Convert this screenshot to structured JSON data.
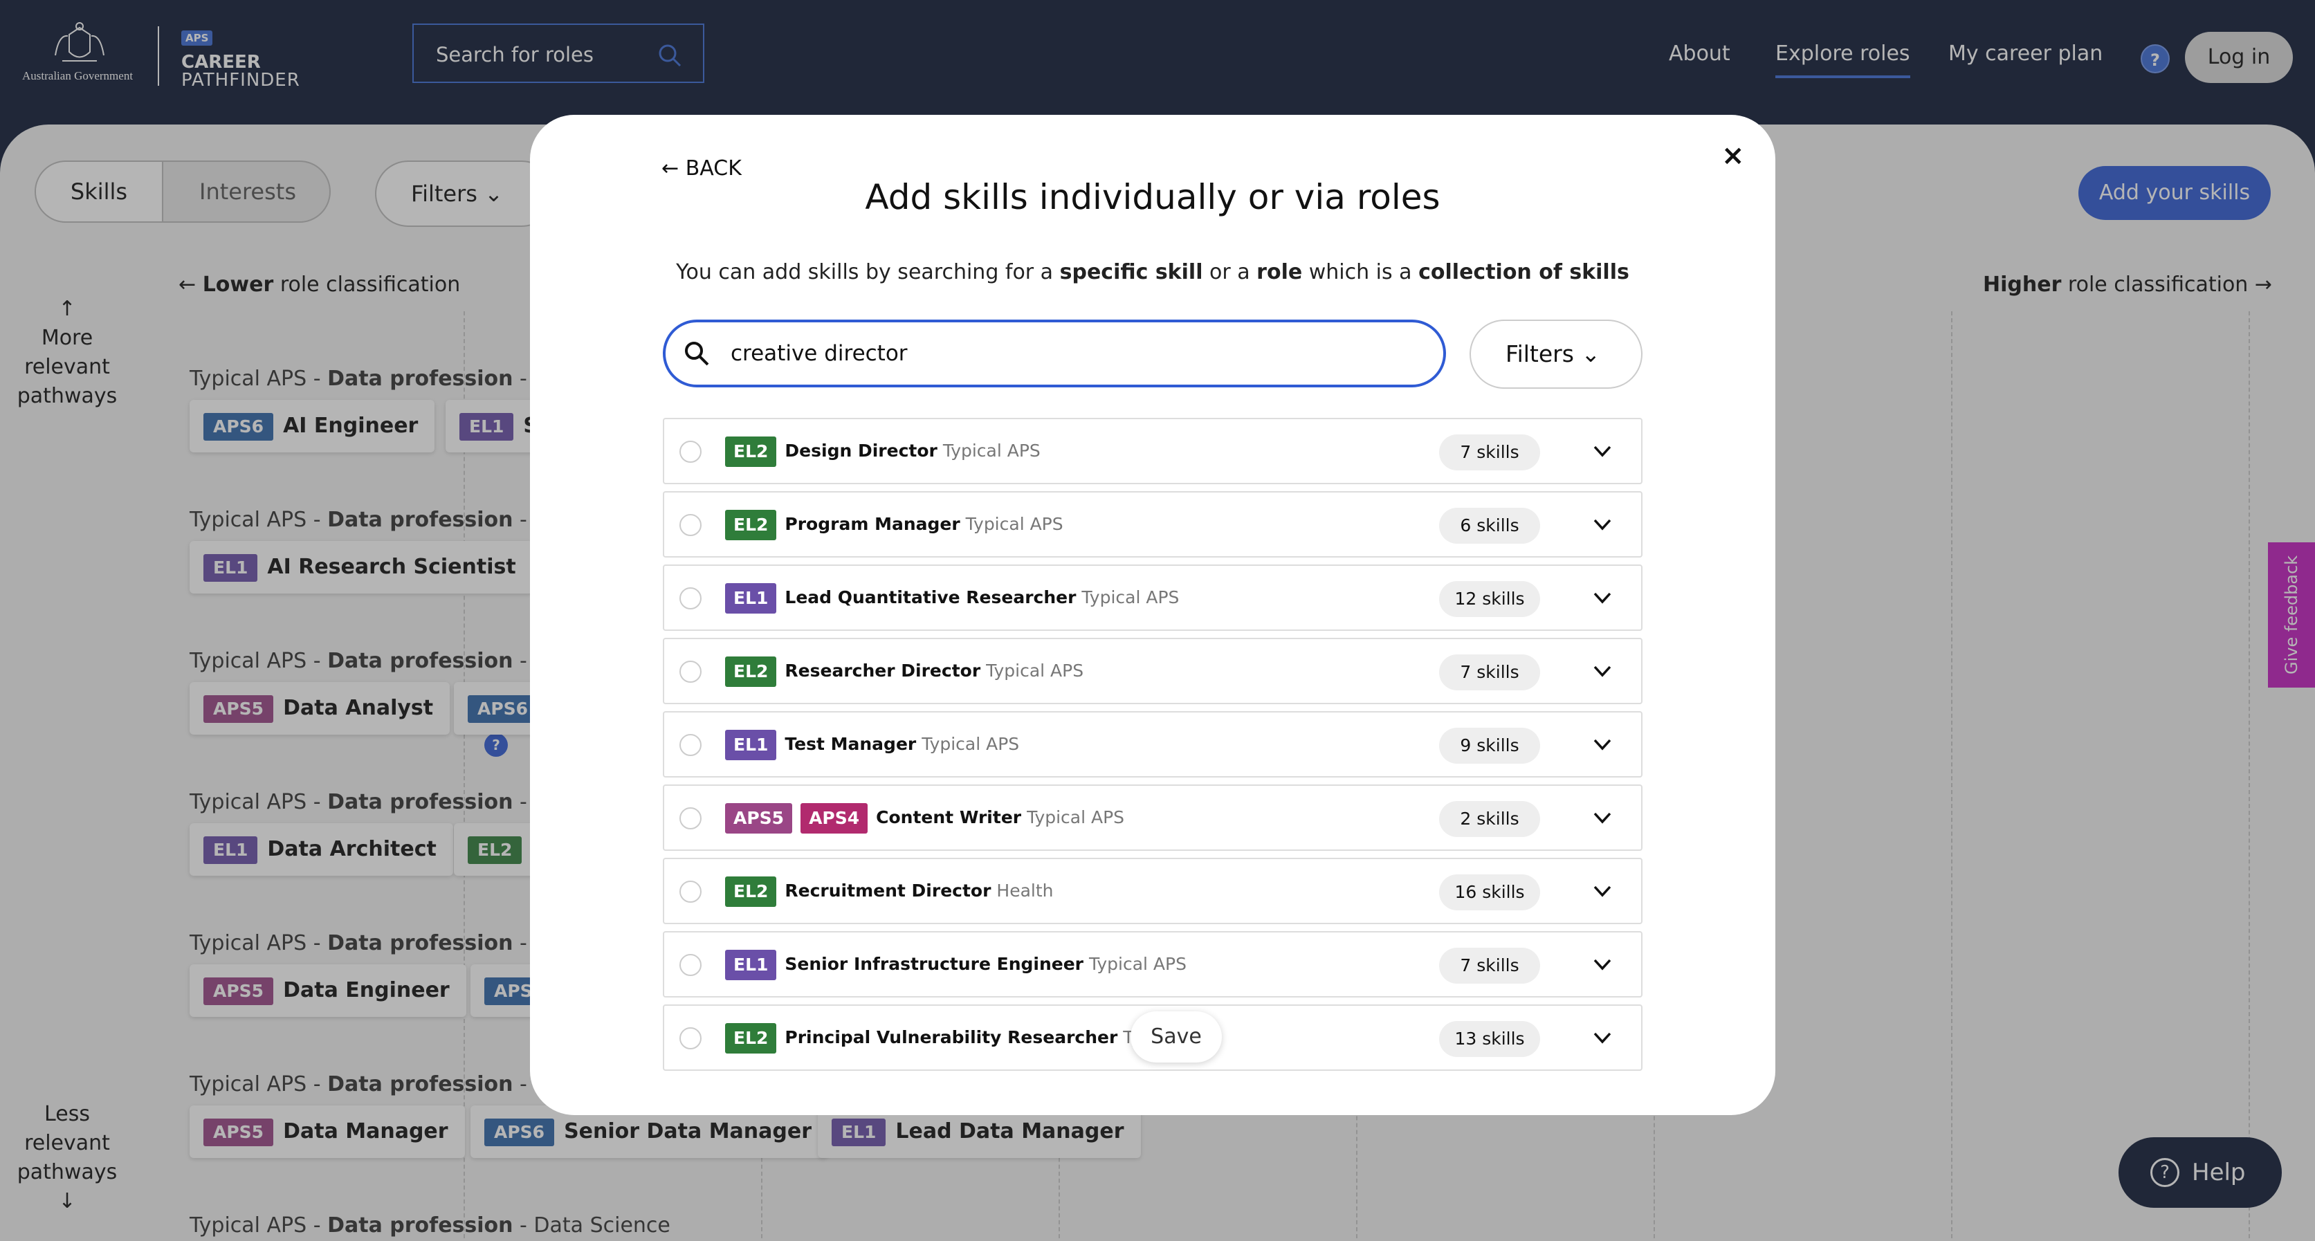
{
  "header": {
    "gov_text": "Australian Government",
    "aps_badge": "APS",
    "career": "CAREER",
    "pathfinder": "PATHFINDER",
    "search_placeholder": "Search for roles",
    "nav": [
      "About",
      "Explore roles",
      "My career plan"
    ],
    "help_q": "?",
    "login": "Log in"
  },
  "background": {
    "toggle": [
      "Skills",
      "Interests"
    ],
    "filters": "Filters",
    "add_skills": "Add your skills",
    "lower_arrow": "←",
    "lower_bold": "Lower",
    "lower_rest": " role classification",
    "higher_bold": "Higher",
    "higher_rest": " role classification",
    "higher_arrow": "→",
    "more_relevant": "More relevant pathways",
    "less_relevant": "Less relevant pathways",
    "rows": [
      {
        "prefix": "Typical APS - ",
        "bold": "Data profession",
        "suffix": " - App",
        "chips": [
          {
            "tag": "APS6",
            "label": "AI Engineer"
          },
          {
            "tag": "EL1",
            "label": "S"
          }
        ]
      },
      {
        "prefix": "Typical APS - ",
        "bold": "Data profession",
        "suffix": " - AI R",
        "chips": [
          {
            "tag": "EL1",
            "label": "AI Research Scientist"
          }
        ]
      },
      {
        "prefix": "Typical APS - ",
        "bold": "Data profession",
        "suffix": " - Data",
        "chips": [
          {
            "tag": "APS5",
            "label": "Data Analyst"
          },
          {
            "tag": "APS6",
            "label": ""
          }
        ]
      },
      {
        "prefix": "Typical APS - ",
        "bold": "Data profession",
        "suffix": " - Data",
        "chips": [
          {
            "tag": "EL1",
            "label": "Data Architect"
          },
          {
            "tag": "EL2",
            "label": ""
          }
        ]
      },
      {
        "prefix": "Typical APS - ",
        "bold": "Data profession",
        "suffix": " - Data",
        "chips": [
          {
            "tag": "APS5",
            "label": "Data Engineer"
          },
          {
            "tag": "APS",
            "label": ""
          }
        ]
      },
      {
        "prefix": "Typical APS - ",
        "bold": "Data profession",
        "suffix": " - Data",
        "chips": [
          {
            "tag": "APS5",
            "label": "Data Manager"
          },
          {
            "tag": "APS6",
            "label": "Senior Data Manager"
          },
          {
            "tag": "EL1",
            "label": "Lead Data Manager"
          }
        ]
      },
      {
        "prefix": "Typical APS - ",
        "bold": "Data profession",
        "suffix": " - Data Science",
        "chips": []
      }
    ],
    "feedback": "Give feedback",
    "help": "Help"
  },
  "modal": {
    "back": "BACK",
    "close": "×",
    "title": "Add skills individually or via roles",
    "subtitle": {
      "a": "You can add skills by searching for a ",
      "b": "specific skill",
      "c": " or a ",
      "d": "role",
      "e": " which is a ",
      "f": "collection of skills"
    },
    "search_value": "creative director",
    "filters": "Filters",
    "results": [
      {
        "tags": [
          "EL2"
        ],
        "name_pre": "Design ",
        "name_bold": "Director",
        "name_post": "",
        "org": "Typical APS",
        "count": "7 skills"
      },
      {
        "tags": [
          "EL2"
        ],
        "name_pre": "Program Manager",
        "name_bold": "",
        "name_post": "",
        "org": "Typical APS",
        "count": "6 skills"
      },
      {
        "tags": [
          "EL1"
        ],
        "name_pre": "Lead Quantitative Researcher",
        "name_bold": "",
        "name_post": "",
        "org": "Typical APS",
        "count": "12 skills"
      },
      {
        "tags": [
          "EL2"
        ],
        "name_pre": "Researcher ",
        "name_bold": "Director",
        "name_post": "",
        "org": "Typical APS",
        "count": "7 skills"
      },
      {
        "tags": [
          "EL1"
        ],
        "name_pre": "Test Manager",
        "name_bold": "",
        "name_post": "",
        "org": "Typical APS",
        "count": "9 skills"
      },
      {
        "tags": [
          "APS5",
          "APS4"
        ],
        "name_pre": "Content Writer",
        "name_bold": "",
        "name_post": "",
        "org": "Typical APS",
        "count": "2 skills"
      },
      {
        "tags": [
          "EL2"
        ],
        "name_pre": "Recruitment ",
        "name_bold": "Director",
        "name_post": "",
        "org": "Health",
        "count": "16 skills"
      },
      {
        "tags": [
          "EL1"
        ],
        "name_pre": "Senior Infrastructure Engineer",
        "name_bold": "",
        "name_post": "",
        "org": "Typical APS",
        "count": "7 skills"
      },
      {
        "tags": [
          "EL2"
        ],
        "name_pre": "Principal Vulnerability Researcher",
        "name_bold": "",
        "name_post": "",
        "org": "Typic",
        "count": "13 skills"
      }
    ],
    "save": "Save"
  },
  "colors": {
    "navy": "#0f1a36",
    "blue": "#2f5bd4",
    "aps6": "#2f66a8",
    "el1": "#6a4fa8",
    "aps5": "#9a4686",
    "el2": "#2f7d3a",
    "aps4": "#b12a6e",
    "feedback": "#c21ebe"
  }
}
